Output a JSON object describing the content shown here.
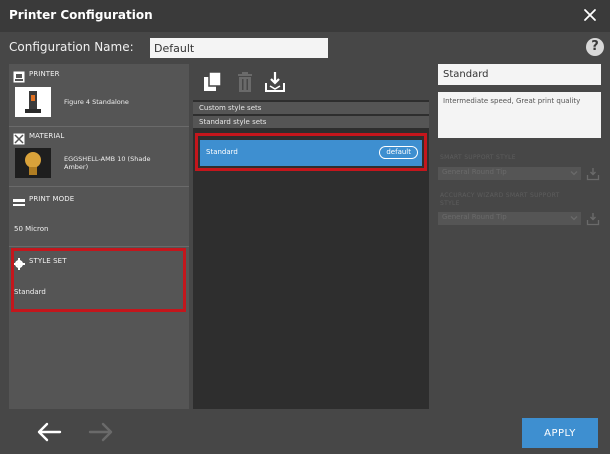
{
  "window": {
    "title": "Printer Configuration"
  },
  "config": {
    "label": "Configuration Name:",
    "value": "Default"
  },
  "help": {
    "glyph": "?"
  },
  "left": {
    "printer": {
      "heading": "PRINTER",
      "name": "Figure 4 Standalone"
    },
    "material": {
      "heading": "MATERIAL",
      "name_line1": "EGGSHELL-AMB 10 (Shade",
      "name_line2": "Amber)"
    },
    "print_mode": {
      "heading": "PRINT MODE",
      "value": "50 Micron"
    },
    "style_set": {
      "heading": "STYLE SET",
      "value": "Standard"
    }
  },
  "middle": {
    "group_custom": "Custom style sets",
    "group_standard": "Standard style sets",
    "selected": {
      "name": "Standard",
      "badge": "default"
    }
  },
  "right": {
    "name_value": "Standard",
    "description": "Intermediate speed, Great print quality",
    "smart_support_label": "SMART SUPPORT STYLE",
    "smart_support_value": "General Round Tip",
    "accuracy_label_line1": "ACCURACY WIZARD SMART SUPPORT",
    "accuracy_label_line2": "STYLE",
    "accuracy_value": "General Round Tip"
  },
  "footer": {
    "apply_label": "APPLY"
  },
  "colors": {
    "accent": "#3e8fd0",
    "highlight": "#c4161c",
    "panel": "#474747"
  }
}
